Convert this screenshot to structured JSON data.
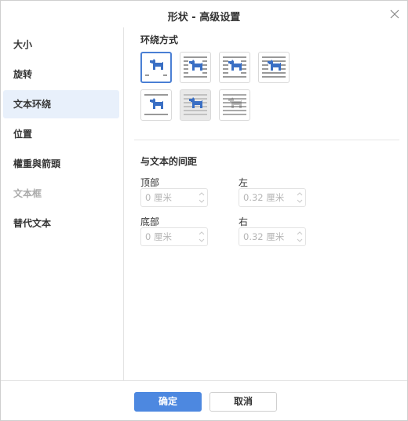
{
  "dialog": {
    "title": "形状 - 高级设置",
    "close_icon": "close-icon"
  },
  "sidebar": {
    "items": [
      {
        "label": "大小",
        "state": "normal"
      },
      {
        "label": "旋转",
        "state": "normal"
      },
      {
        "label": "文本环绕",
        "state": "active"
      },
      {
        "label": "位置",
        "state": "normal"
      },
      {
        "label": "權重與箭頭",
        "state": "normal"
      },
      {
        "label": "文本框",
        "state": "disabled"
      },
      {
        "label": "替代文本",
        "state": "normal"
      }
    ]
  },
  "wrap": {
    "title": "环绕方式",
    "styles": [
      {
        "icon": "wrap-inline-icon",
        "state": "selected"
      },
      {
        "icon": "wrap-square-icon",
        "state": "normal"
      },
      {
        "icon": "wrap-tight-icon",
        "state": "normal"
      },
      {
        "icon": "wrap-through-icon",
        "state": "normal"
      },
      {
        "icon": "wrap-top-bottom-icon",
        "state": "normal"
      },
      {
        "icon": "wrap-in-front-icon",
        "state": "disabled"
      },
      {
        "icon": "wrap-behind-icon",
        "state": "disabled"
      }
    ]
  },
  "distance": {
    "title": "与文本的间距",
    "top": {
      "label": "顶部",
      "value": "0 厘米"
    },
    "left": {
      "label": "左",
      "value": "0.32 厘米"
    },
    "bottom": {
      "label": "底部",
      "value": "0 厘米"
    },
    "right": {
      "label": "右",
      "value": "0.32 厘米"
    }
  },
  "footer": {
    "ok_label": "确定",
    "cancel_label": "取消"
  },
  "colors": {
    "accent": "#4d88e0",
    "icon_blue": "#3a6fc4",
    "active_bg": "#e8f0fb"
  }
}
